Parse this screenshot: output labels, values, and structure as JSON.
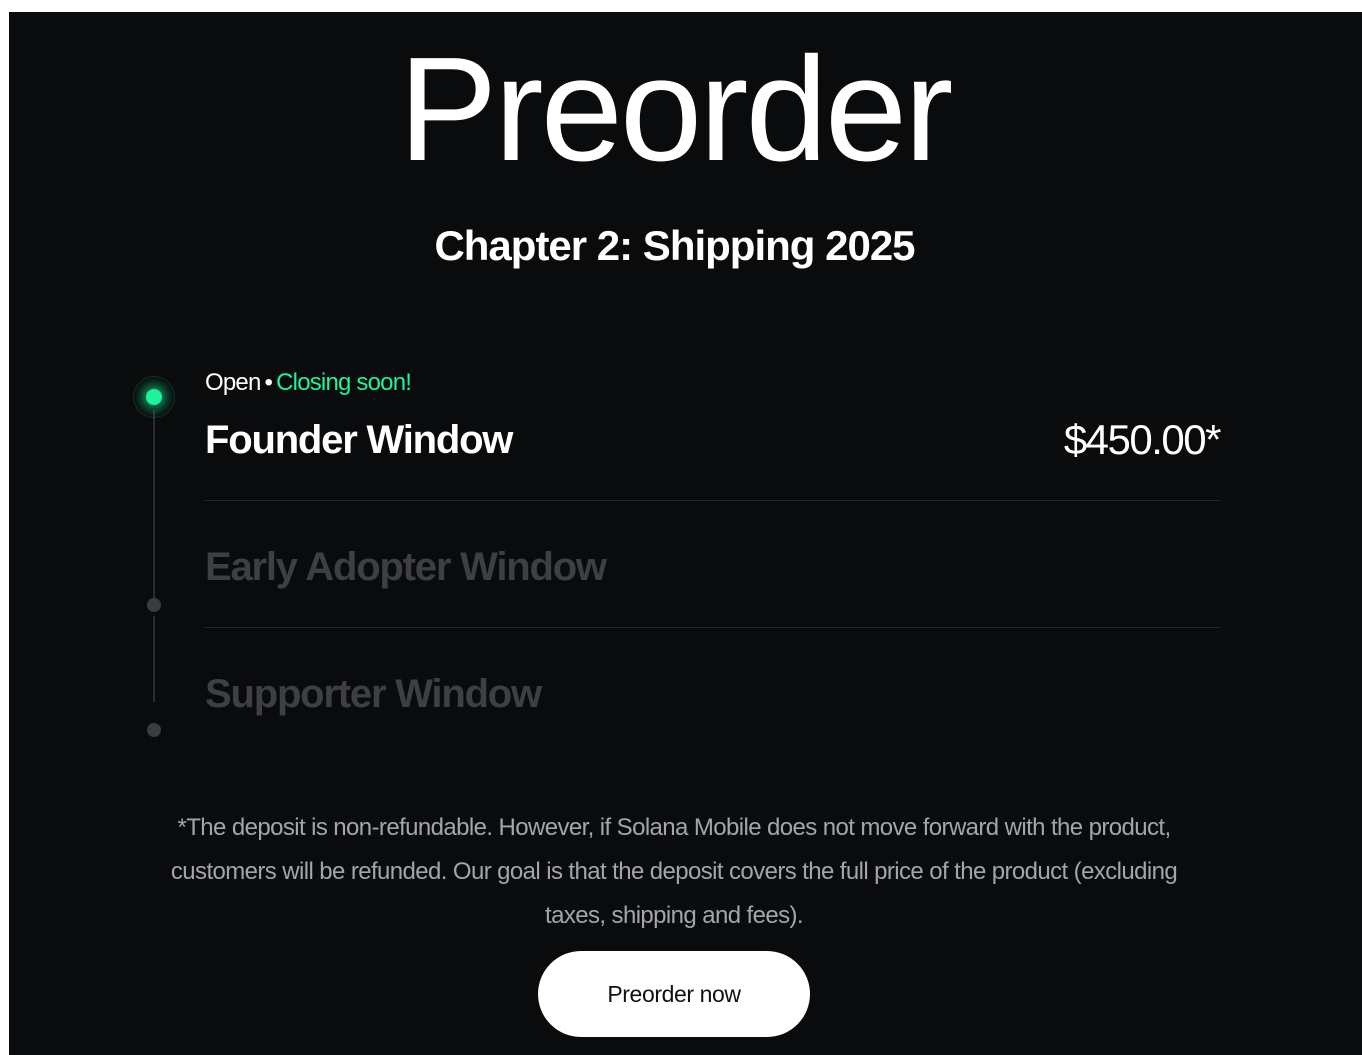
{
  "header": {
    "title": "Preorder",
    "subtitle": "Chapter 2: Shipping 2025"
  },
  "status": {
    "open": "Open",
    "separator": "•",
    "closing": "Closing soon!"
  },
  "windows": [
    {
      "name": "Founder Window",
      "price": "$450.00*",
      "active": true
    },
    {
      "name": "Early Adopter Window",
      "active": false
    },
    {
      "name": "Supporter Window",
      "active": false
    }
  ],
  "disclaimer": "*The deposit is non-refundable. However, if Solana Mobile does not move forward with the product, customers will be refunded. Our goal is that the deposit covers the full price of the product (excluding taxes, shipping and fees).",
  "cta": {
    "label": "Preorder now"
  },
  "colors": {
    "background": "#0a0b0d",
    "accent": "#1ef29a",
    "inactive_text": "#3d3f45",
    "button_bg": "#ffffff"
  }
}
